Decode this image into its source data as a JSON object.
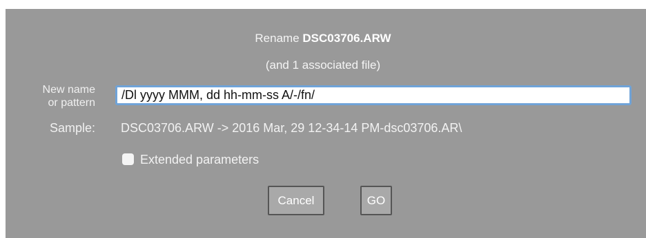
{
  "dialog": {
    "title_prefix": "Rename",
    "file_name": "DSC03706.ARW",
    "subtitle": "(and 1 associated file)"
  },
  "new_name": {
    "label_line1": "New name",
    "label_line2": "or pattern",
    "value": "/Dl yyyy MMM, dd hh-mm-ss A/-/fn/"
  },
  "sample": {
    "label": "Sample:",
    "value": "DSC03706.ARW ->  2016 Mar, 29 12-34-14 PM-dsc03706.AR\\"
  },
  "extended": {
    "label": "Extended parameters",
    "checked": false
  },
  "buttons": {
    "cancel": "Cancel",
    "go": "GO"
  },
  "colors": {
    "dialog_bg": "#999999",
    "input_focus_border": "#6fa3d8"
  }
}
